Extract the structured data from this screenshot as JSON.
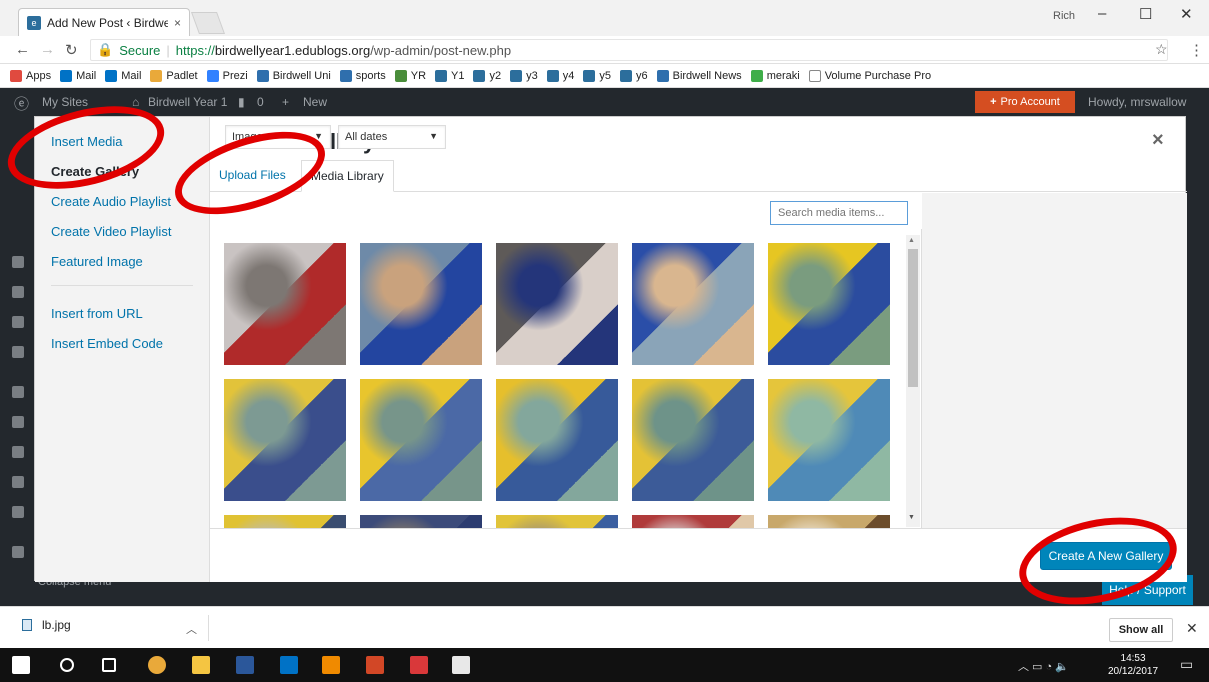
{
  "browser": {
    "tab_title": "Add New Post ‹ Birdwell",
    "tab_close": "×",
    "user": "Rich",
    "window_controls": [
      "–",
      "☐",
      "✕"
    ],
    "secure_label": "Secure",
    "url_scheme": "https://",
    "url_host": "birdwellyear1.edublogs.org",
    "url_path": "/wp-admin/post-new.php",
    "bookmarks": [
      {
        "label": "Apps",
        "color": "#e04a3f"
      },
      {
        "label": "Mail",
        "color": "#0072c6"
      },
      {
        "label": "Mail",
        "color": "#0072c6"
      },
      {
        "label": "Padlet",
        "color": "#e9a93a"
      },
      {
        "label": "Prezi",
        "color": "#3181ff"
      },
      {
        "label": "Birdwell Uni",
        "color": "#2f6fad"
      },
      {
        "label": "sports",
        "color": "#2f6fad"
      },
      {
        "label": "YR",
        "color": "#4a8d3a"
      },
      {
        "label": "Y1",
        "color": "#2c6e9c"
      },
      {
        "label": "y2",
        "color": "#2c6e9c"
      },
      {
        "label": "y3",
        "color": "#2c6e9c"
      },
      {
        "label": "y4",
        "color": "#2c6e9c"
      },
      {
        "label": "y5",
        "color": "#2c6e9c"
      },
      {
        "label": "y6",
        "color": "#2c6e9c"
      },
      {
        "label": "Birdwell News",
        "color": "#2f6fad"
      },
      {
        "label": "meraki",
        "color": "#3fae49"
      },
      {
        "label": "Volume Purchase Pro",
        "color": "#ffffff"
      }
    ]
  },
  "wpbar": {
    "my_sites": "My Sites",
    "site": "Birdwell Year 1",
    "comments": "0",
    "new": "New",
    "pro": "Pro Account",
    "howdy": "Howdy, mrswallow"
  },
  "modal": {
    "title": "Create Gallery",
    "close": "×",
    "nav": [
      "Insert Media",
      "Create Gallery",
      "Create Audio Playlist",
      "Create Video Playlist",
      "Featured Image",
      "Insert from URL",
      "Insert Embed Code"
    ],
    "tabs": [
      "Upload Files",
      "Media Library"
    ],
    "filter_type": "Images",
    "filter_date": "All dates",
    "search_placeholder": "Search media items...",
    "create_button": "Create A New Gallery"
  },
  "thumbnails": [
    {
      "colors": [
        "#c9c3c2",
        "#b02a2a",
        "#7d7773"
      ]
    },
    {
      "colors": [
        "#6e8aa8",
        "#2345a0",
        "#c9a27d"
      ]
    },
    {
      "colors": [
        "#5e5a58",
        "#d9cfc9",
        "#24357a"
      ]
    },
    {
      "colors": [
        "#2a4ea8",
        "#8aa4b8",
        "#d9b68f"
      ]
    },
    {
      "colors": [
        "#e6c622",
        "#2b4c9f",
        "#7a9c7f"
      ]
    },
    {
      "colors": [
        "#e2c33a",
        "#3a4e8c",
        "#7d9a93"
      ]
    },
    {
      "colors": [
        "#e8c52d",
        "#4b69a6",
        "#77958a"
      ]
    },
    {
      "colors": [
        "#e6bf2c",
        "#375a9a",
        "#83a79c"
      ]
    },
    {
      "colors": [
        "#e4c236",
        "#3c5b98",
        "#6e9389"
      ]
    },
    {
      "colors": [
        "#e5c53b",
        "#4f8ab7",
        "#8fb8a3"
      ]
    },
    {
      "colors": [
        "#e0c233",
        "#3a4d70",
        "#bbb"
      ]
    },
    {
      "colors": [
        "#3c4b7a",
        "#2c3c70",
        "#8b7e6a"
      ]
    },
    {
      "colors": [
        "#e1c43a",
        "#3b5fa0",
        "#9b8d7a"
      ]
    },
    {
      "colors": [
        "#b03b3b",
        "#e0c8a8",
        "#ddd"
      ]
    },
    {
      "colors": [
        "#c8a86b",
        "#6c4d2c",
        "#efe6d5"
      ]
    }
  ],
  "help": "Help / Support",
  "collapse": "Collapse menu",
  "downloads": {
    "file": "lb.jpg",
    "show_all": "Show all",
    "close": "✕"
  },
  "taskbar": {
    "time": "14:53",
    "date": "20/12/2017",
    "apps": [
      {
        "name": "windows",
        "color": "#ffffff"
      },
      {
        "name": "search",
        "color": "#ffffff"
      },
      {
        "name": "task-view",
        "color": "#ffffff"
      },
      {
        "name": "chrome",
        "color": "#e9a93a"
      },
      {
        "name": "file-explorer",
        "color": "#f4c542"
      },
      {
        "name": "word",
        "color": "#2b579a"
      },
      {
        "name": "outlook",
        "color": "#0072c6"
      },
      {
        "name": "vlc",
        "color": "#f08a00"
      },
      {
        "name": "powerpoint",
        "color": "#d24726"
      },
      {
        "name": "edublogs",
        "color": "#d9383a"
      },
      {
        "name": "photos",
        "color": "#e8e8e8"
      }
    ]
  }
}
